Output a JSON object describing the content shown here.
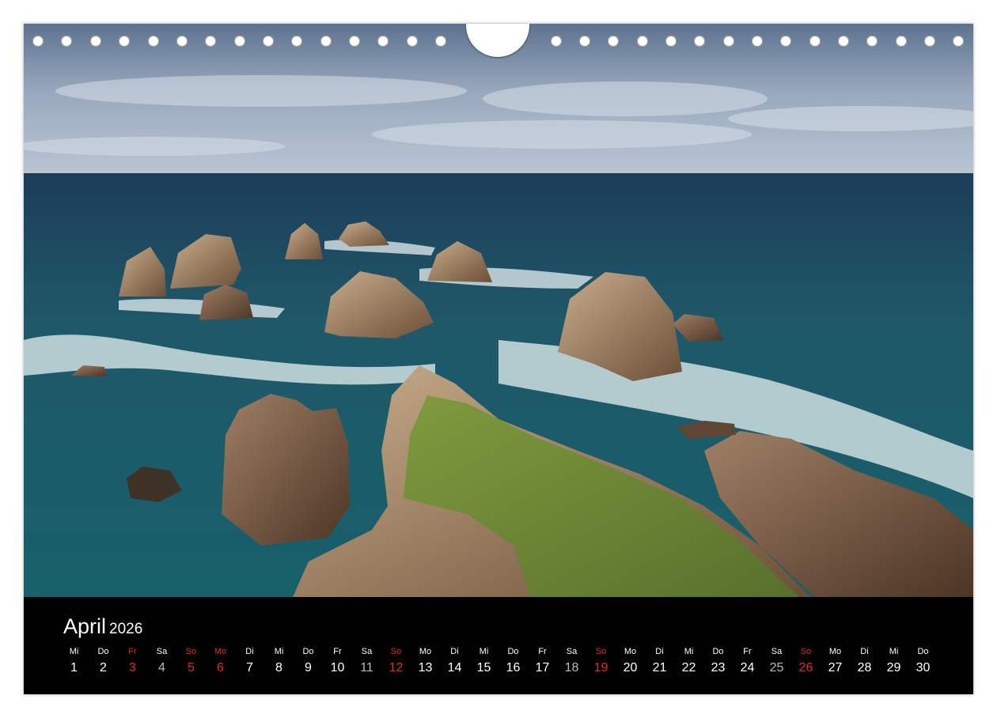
{
  "calendar": {
    "month": "April",
    "year": "2026",
    "days": [
      {
        "dn": "Mi",
        "d": "1",
        "type": "normal"
      },
      {
        "dn": "Do",
        "d": "2",
        "type": "normal"
      },
      {
        "dn": "Fr",
        "d": "3",
        "type": "red"
      },
      {
        "dn": "Sa",
        "d": "4",
        "type": "sat"
      },
      {
        "dn": "So",
        "d": "5",
        "type": "red"
      },
      {
        "dn": "Mo",
        "d": "6",
        "type": "red"
      },
      {
        "dn": "Di",
        "d": "7",
        "type": "normal"
      },
      {
        "dn": "Mi",
        "d": "8",
        "type": "normal"
      },
      {
        "dn": "Do",
        "d": "9",
        "type": "normal"
      },
      {
        "dn": "Fr",
        "d": "10",
        "type": "normal"
      },
      {
        "dn": "Sa",
        "d": "11",
        "type": "sat"
      },
      {
        "dn": "So",
        "d": "12",
        "type": "red"
      },
      {
        "dn": "Mo",
        "d": "13",
        "type": "normal"
      },
      {
        "dn": "Di",
        "d": "14",
        "type": "normal"
      },
      {
        "dn": "Mi",
        "d": "15",
        "type": "normal"
      },
      {
        "dn": "Do",
        "d": "16",
        "type": "normal"
      },
      {
        "dn": "Fr",
        "d": "17",
        "type": "normal"
      },
      {
        "dn": "Sa",
        "d": "18",
        "type": "sat"
      },
      {
        "dn": "So",
        "d": "19",
        "type": "red"
      },
      {
        "dn": "Mo",
        "d": "20",
        "type": "normal"
      },
      {
        "dn": "Di",
        "d": "21",
        "type": "normal"
      },
      {
        "dn": "Mi",
        "d": "22",
        "type": "normal"
      },
      {
        "dn": "Do",
        "d": "23",
        "type": "normal"
      },
      {
        "dn": "Fr",
        "d": "24",
        "type": "normal"
      },
      {
        "dn": "Sa",
        "d": "25",
        "type": "sat"
      },
      {
        "dn": "So",
        "d": "26",
        "type": "red"
      },
      {
        "dn": "Mo",
        "d": "27",
        "type": "normal"
      },
      {
        "dn": "Di",
        "d": "28",
        "type": "normal"
      },
      {
        "dn": "Mi",
        "d": "29",
        "type": "normal"
      },
      {
        "dn": "Do",
        "d": "30",
        "type": "normal"
      }
    ]
  },
  "colors": {
    "holiday_red": "#e8272f",
    "saturday_gray": "#bbbbbb",
    "bar_black": "#000000"
  }
}
